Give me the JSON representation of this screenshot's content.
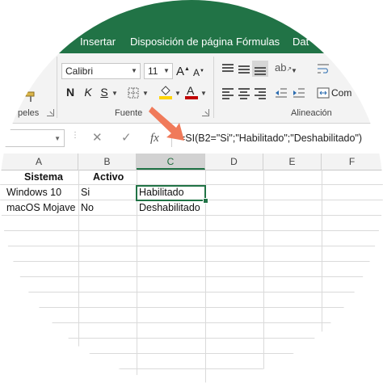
{
  "ribbon": {
    "tabs": [
      "Insertar",
      "Disposición de página",
      "Fórmulas",
      "Dat"
    ],
    "font_name": "Calibri",
    "font_size": "11",
    "bold": "N",
    "italic": "K",
    "underline": "S",
    "group_labels": {
      "clipboard": "peles",
      "font": "Fuente",
      "alignment": "Alineación"
    },
    "wrap_partial": "Com",
    "accent_color": "#217346",
    "fill_color": "#ffd400",
    "font_color": "#c00000"
  },
  "formula_bar": {
    "cancel": "✕",
    "enter": "✓",
    "fx": "fx",
    "formula": "=SI(B2=\"Si\";\"Habilitado\";\"Deshabilitado\")"
  },
  "sheet": {
    "columns": [
      "A",
      "B",
      "C",
      "D",
      "E",
      "F"
    ],
    "selected_column": "C",
    "rows": [
      [
        "Sistema",
        "Activo",
        ""
      ],
      [
        "Windows 10",
        "Si",
        "Habilitado"
      ],
      [
        "macOS Mojave",
        "No",
        "Deshabilitado"
      ]
    ]
  }
}
